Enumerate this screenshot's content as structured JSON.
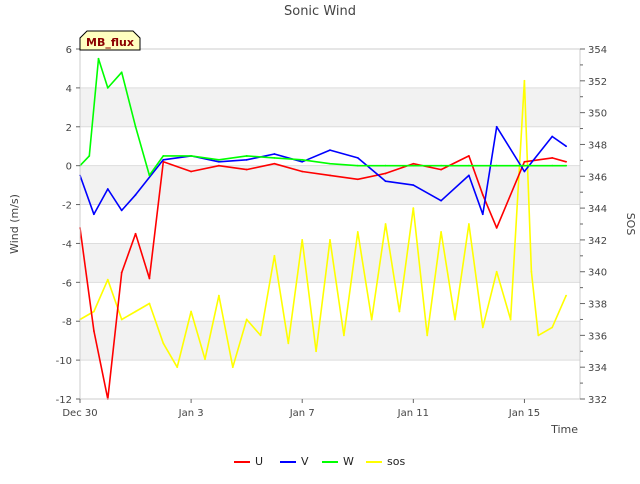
{
  "chart_data": {
    "type": "line",
    "title": "Sonic Wind",
    "badge": "MB_flux",
    "xlabel": "Time",
    "ylabel": "Wind (m/s)",
    "y2label": "SOS",
    "x_range": [
      "2022-12-30",
      "2023-01-17"
    ],
    "x_ticks": [
      {
        "date": "2022-12-30",
        "label": "Dec 30"
      },
      {
        "date": "2023-01-03",
        "label": "Jan 3"
      },
      {
        "date": "2023-01-07",
        "label": "Jan 7"
      },
      {
        "date": "2023-01-11",
        "label": "Jan 11"
      },
      {
        "date": "2023-01-15",
        "label": "Jan 15"
      }
    ],
    "ylim": [
      -12,
      6
    ],
    "y_ticks": [
      "6",
      "4",
      "2",
      "0",
      "-2",
      "-4",
      "-6",
      "-8",
      "-10",
      "-12"
    ],
    "y2lim": [
      332,
      354
    ],
    "y2_ticks": [
      "354",
      "352",
      "350",
      "348",
      "346",
      "344",
      "342",
      "340",
      "338",
      "336",
      "334",
      "332"
    ],
    "grid": true,
    "legend_position": "bottom",
    "colors": {
      "U": "#ff0000",
      "V": "#0000ff",
      "W": "#00ff00",
      "sos": "#ffff00"
    },
    "series": [
      {
        "name": "U",
        "axis": "left",
        "x": [
          "2022-12-30",
          "2022-12-30 12:00",
          "2022-12-31",
          "2022-12-31 12:00",
          "2023-01-01",
          "2023-01-01 12:00",
          "2023-01-02",
          "2023-01-03",
          "2023-01-04",
          "2023-01-05",
          "2023-01-06",
          "2023-01-07",
          "2023-01-08",
          "2023-01-09",
          "2023-01-10",
          "2023-01-11",
          "2023-01-12",
          "2023-01-13",
          "2023-01-13 12:00",
          "2023-01-14",
          "2023-01-15",
          "2023-01-16",
          "2023-01-16 12:00"
        ],
        "values": [
          -3.2,
          -8.5,
          -12,
          -5.5,
          -3.5,
          -5.8,
          0.2,
          -0.3,
          0,
          -0.2,
          0.1,
          -0.3,
          -0.5,
          -0.7,
          -0.4,
          0.1,
          -0.2,
          0.5,
          -1.5,
          -3.2,
          0.2,
          0.4,
          0.2
        ]
      },
      {
        "name": "V",
        "axis": "left",
        "x": [
          "2022-12-30",
          "2022-12-30 12:00",
          "2022-12-31",
          "2022-12-31 12:00",
          "2023-01-01",
          "2023-01-02",
          "2023-01-03",
          "2023-01-04",
          "2023-01-05",
          "2023-01-06",
          "2023-01-07",
          "2023-01-08",
          "2023-01-09",
          "2023-01-10",
          "2023-01-11",
          "2023-01-12",
          "2023-01-13",
          "2023-01-13 12:00",
          "2023-01-14",
          "2023-01-15",
          "2023-01-16",
          "2023-01-16 12:00"
        ],
        "values": [
          -0.5,
          -2.5,
          -1.2,
          -2.3,
          -1.5,
          0.3,
          0.5,
          0.2,
          0.3,
          0.6,
          0.2,
          0.8,
          0.4,
          -0.8,
          -1,
          -1.8,
          -0.5,
          -2.5,
          2,
          -0.3,
          1.5,
          1
        ]
      },
      {
        "name": "W",
        "axis": "left",
        "x": [
          "2022-12-30",
          "2022-12-30 08:00",
          "2022-12-30 16:00",
          "2022-12-31",
          "2022-12-31 12:00",
          "2023-01-01",
          "2023-01-01 12:00",
          "2023-01-02",
          "2023-01-03",
          "2023-01-04",
          "2023-01-05",
          "2023-01-06",
          "2023-01-07",
          "2023-01-08",
          "2023-01-09",
          "2023-01-10",
          "2023-01-11",
          "2023-01-12",
          "2023-01-13",
          "2023-01-14",
          "2023-01-15",
          "2023-01-16",
          "2023-01-16 12:00"
        ],
        "values": [
          0,
          0.5,
          5.5,
          4,
          4.8,
          2,
          -0.5,
          0.5,
          0.5,
          0.3,
          0.5,
          0.4,
          0.3,
          0.1,
          0,
          0,
          0,
          0,
          0,
          0,
          0,
          0,
          0
        ]
      },
      {
        "name": "sos",
        "axis": "right",
        "x": [
          "2022-12-30",
          "2022-12-30 12:00",
          "2022-12-31",
          "2022-12-31 12:00",
          "2023-01-01",
          "2023-01-01 12:00",
          "2023-01-02",
          "2023-01-02 12:00",
          "2023-01-03",
          "2023-01-03 12:00",
          "2023-01-04",
          "2023-01-04 12:00",
          "2023-01-05",
          "2023-01-05 12:00",
          "2023-01-06",
          "2023-01-06 12:00",
          "2023-01-07",
          "2023-01-07 12:00",
          "2023-01-08",
          "2023-01-08 12:00",
          "2023-01-09",
          "2023-01-09 12:00",
          "2023-01-10",
          "2023-01-10 12:00",
          "2023-01-11",
          "2023-01-11 12:00",
          "2023-01-12",
          "2023-01-12 12:00",
          "2023-01-13",
          "2023-01-13 12:00",
          "2023-01-14",
          "2023-01-14 12:00",
          "2023-01-15",
          "2023-01-15 06:00",
          "2023-01-15 12:00",
          "2023-01-16",
          "2023-01-16 12:00"
        ],
        "values": [
          337,
          337.5,
          339.5,
          337,
          337.5,
          338,
          335.5,
          334,
          337.5,
          334.5,
          338.5,
          334,
          337,
          336,
          341,
          335.5,
          342,
          335,
          342,
          336,
          342.5,
          337,
          343,
          337.5,
          344,
          336,
          342.5,
          337,
          343,
          336.5,
          340,
          337,
          352,
          340,
          336,
          336.5,
          338.5
        ]
      }
    ]
  },
  "legend": {
    "u": "U",
    "v": "V",
    "w": "W",
    "sos": "sos"
  }
}
